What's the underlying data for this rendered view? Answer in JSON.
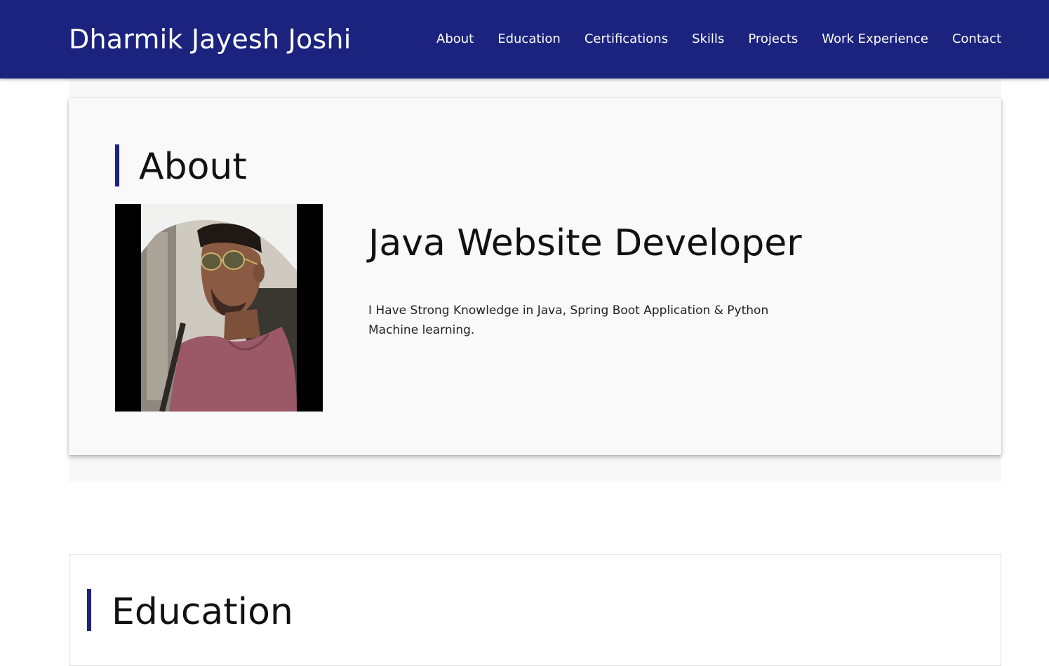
{
  "header": {
    "brand": "Dharmik Jayesh Joshi",
    "nav": [
      "About",
      "Education",
      "Certifications",
      "Skills",
      "Projects",
      "Work Experience",
      "Contact"
    ]
  },
  "about": {
    "title": "About",
    "photo_alt": "profile-photo",
    "headline": "Java Website Developer",
    "description": "I Have Strong Knowledge in Java, Spring Boot Application & Python Machine learning."
  },
  "education": {
    "title": "Education"
  },
  "colors": {
    "brand_navy": "#1b237e",
    "card_bg": "#f9f9f9"
  }
}
